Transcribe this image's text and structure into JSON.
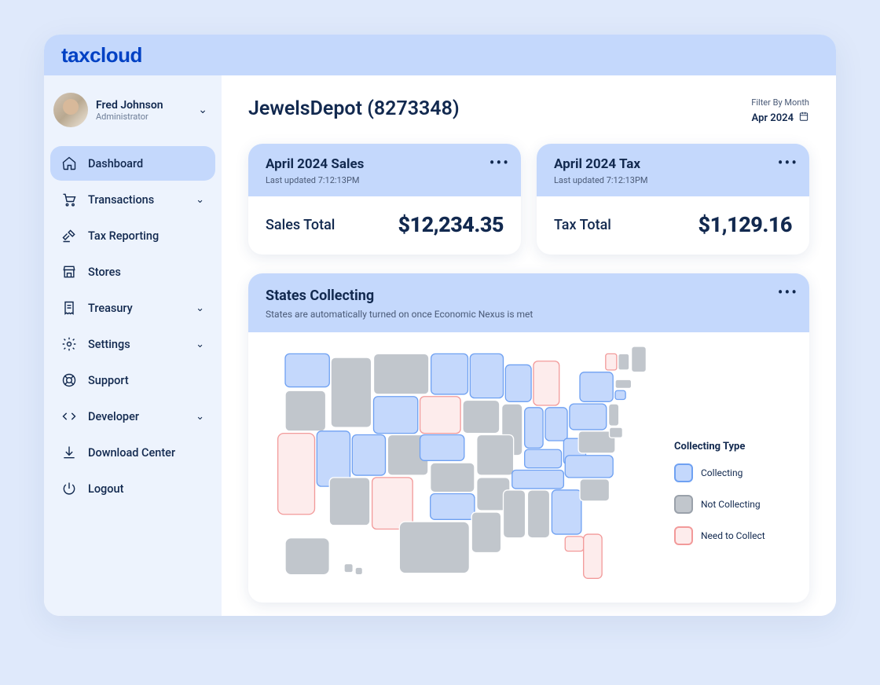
{
  "brand": "taxcloud",
  "user": {
    "name": "Fred Johnson",
    "role": "Administrator"
  },
  "nav": {
    "dashboard": "Dashboard",
    "transactions": "Transactions",
    "tax_reporting": "Tax Reporting",
    "stores": "Stores",
    "treasury": "Treasury",
    "settings": "Settings",
    "support": "Support",
    "developer": "Developer",
    "download_center": "Download Center",
    "logout": "Logout"
  },
  "header": {
    "title": "JewelsDepot (8273348)",
    "filter_label": "Filter By Month",
    "filter_value": "Apr 2024"
  },
  "sales_card": {
    "title": "April 2024 Sales",
    "subtitle": "Last updated 7:12:13PM",
    "metric_label": "Sales Total",
    "metric_value": "$12,234.35"
  },
  "tax_card": {
    "title": "April 2024 Tax",
    "subtitle": "Last updated 7:12:13PM",
    "metric_label": "Tax Total",
    "metric_value": "$1,129.16"
  },
  "map_card": {
    "title": "States Collecting",
    "subtitle": "States are automatically turned on once Economic Nexus is met",
    "legend_title": "Collecting Type",
    "legend_collecting": "Collecting",
    "legend_not": "Not Collecting",
    "legend_need": "Need to Collect"
  },
  "chart_data": {
    "type": "map",
    "region": "US states choropleth",
    "categories": [
      "Collecting",
      "Not Collecting",
      "Need to Collect"
    ],
    "colors": {
      "Collecting": "#c4d8fc",
      "Not Collecting": "#c1c6cc",
      "Need to Collect": "#fdecec"
    },
    "data": {
      "WA": "Collecting",
      "OR": "Not Collecting",
      "ID": "Not Collecting",
      "MT": "Not Collecting",
      "ND": "Collecting",
      "MN": "Collecting",
      "WI": "Collecting",
      "MI": "Need to Collect",
      "NY": "Collecting",
      "VT": "Need to Collect",
      "NH": "Not Collecting",
      "ME": "Not Collecting",
      "MA": "Not Collecting",
      "RI": "Not Collecting",
      "CT": "Collecting",
      "WY": "Collecting",
      "SD": "Need to Collect",
      "IA": "Not Collecting",
      "NE": "Collecting",
      "IL": "Not Collecting",
      "IN": "Collecting",
      "OH": "Collecting",
      "PA": "Collecting",
      "NJ": "Not Collecting",
      "CA": "Need to Collect",
      "NV": "Collecting",
      "UT": "Collecting",
      "CO": "Not Collecting",
      "KS": "Not Collecting",
      "MO": "Not Collecting",
      "KY": "Collecting",
      "WV": "Collecting",
      "VA": "Not Collecting",
      "MD": "Not Collecting",
      "DE": "Not Collecting",
      "AZ": "Not Collecting",
      "NM": "Need to Collect",
      "OK": "Collecting",
      "AR": "Not Collecting",
      "TN": "Collecting",
      "NC": "Collecting",
      "TX": "Not Collecting",
      "LA": "Not Collecting",
      "MS": "Not Collecting",
      "AL": "Not Collecting",
      "GA": "Collecting",
      "SC": "Not Collecting",
      "FL": "Need to Collect",
      "AK": "Not Collecting",
      "HI": "Not Collecting"
    }
  }
}
